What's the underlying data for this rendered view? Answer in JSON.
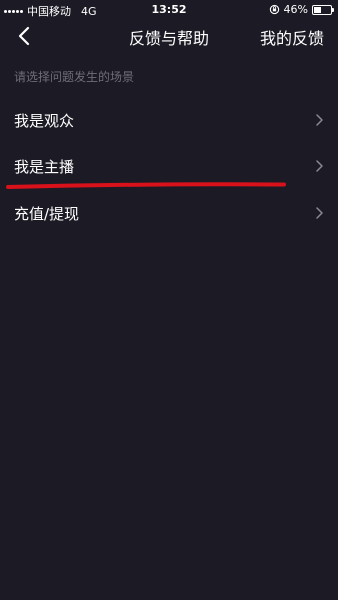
{
  "status_bar": {
    "carrier": "中国移动",
    "network": "4G",
    "time": "13:52",
    "battery_percent": "46%",
    "battery_level": 0.46
  },
  "nav": {
    "back_icon": "chevron-left-icon",
    "title": "反馈与帮助",
    "right_action": "我的反馈"
  },
  "section_hint": "请选择问题发生的场景",
  "menu": {
    "items": [
      {
        "label": "我是观众"
      },
      {
        "label": "我是主播"
      },
      {
        "label": "充值/提现"
      }
    ]
  },
  "colors": {
    "background": "#1c1b25",
    "hint_text": "#6e6d78",
    "chevron": "#8a8994",
    "annotation": "#d8111a"
  }
}
